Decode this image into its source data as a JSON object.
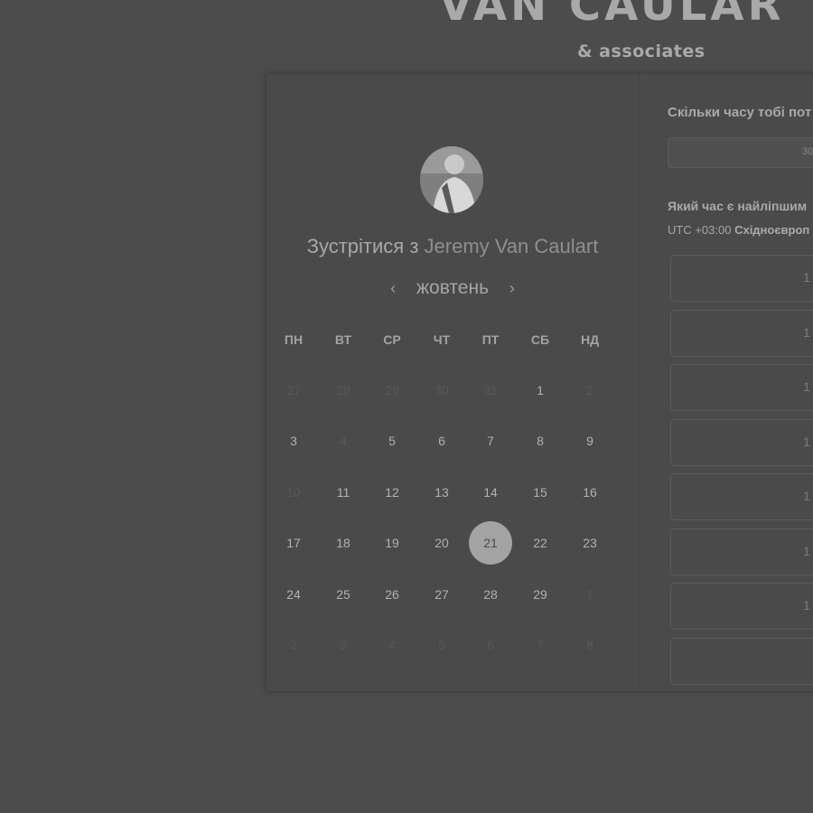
{
  "brand": {
    "name": "VAN CAULAR",
    "subtitle": "& associates"
  },
  "booking": {
    "meet_prefix": "Зустрітися з",
    "host_name": "Jeremy Van Caulart",
    "month": "жовтень",
    "prev_icon": "chevron-left-icon",
    "next_icon": "chevron-right-icon"
  },
  "calendar": {
    "weekdays": [
      "ПН",
      "ВТ",
      "СР",
      "ЧТ",
      "ПТ",
      "СБ",
      "НД"
    ],
    "weeks": [
      [
        {
          "d": "27",
          "muted": true
        },
        {
          "d": "28",
          "muted": true
        },
        {
          "d": "29",
          "muted": true
        },
        {
          "d": "30",
          "muted": true
        },
        {
          "d": "31",
          "muted": true
        },
        {
          "d": "1"
        },
        {
          "d": "2",
          "muted": true
        }
      ],
      [
        {
          "d": "3"
        },
        {
          "d": "4",
          "muted": true
        },
        {
          "d": "5"
        },
        {
          "d": "6"
        },
        {
          "d": "7"
        },
        {
          "d": "8"
        },
        {
          "d": "9"
        }
      ],
      [
        {
          "d": "10",
          "muted": true
        },
        {
          "d": "11"
        },
        {
          "d": "12"
        },
        {
          "d": "13"
        },
        {
          "d": "14"
        },
        {
          "d": "15"
        },
        {
          "d": "16"
        }
      ],
      [
        {
          "d": "17"
        },
        {
          "d": "18"
        },
        {
          "d": "19"
        },
        {
          "d": "20"
        },
        {
          "d": "21",
          "selected": true
        },
        {
          "d": "22"
        },
        {
          "d": "23"
        }
      ],
      [
        {
          "d": "24"
        },
        {
          "d": "25"
        },
        {
          "d": "26"
        },
        {
          "d": "27"
        },
        {
          "d": "28"
        },
        {
          "d": "29"
        },
        {
          "d": "1",
          "muted": true
        }
      ],
      [
        {
          "d": "2",
          "muted": true
        },
        {
          "d": "3",
          "muted": true
        },
        {
          "d": "4",
          "muted": true
        },
        {
          "d": "5",
          "muted": true
        },
        {
          "d": "6",
          "muted": true
        },
        {
          "d": "7",
          "muted": true
        },
        {
          "d": "8",
          "muted": true
        }
      ]
    ]
  },
  "scheduler": {
    "duration_question": "Скільки часу тобі пот",
    "duration_value": "30",
    "time_question": "Який час є найліпшим",
    "tz_offset": "UTC +03:00",
    "tz_name": "Східноєвроп",
    "slots": [
      "1",
      "1",
      "1",
      "1",
      "1",
      "1",
      "1"
    ]
  },
  "colors": {
    "background": "#4c4c4c",
    "panel": "#4a4a4a",
    "selected_day": "#a3a3a3"
  }
}
